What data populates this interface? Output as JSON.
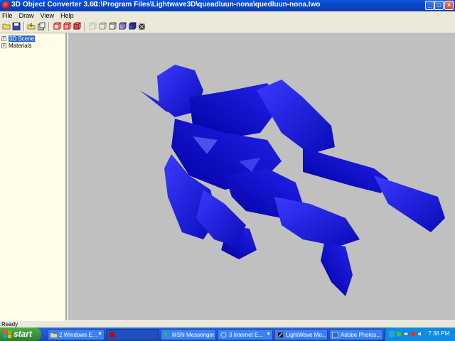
{
  "window": {
    "app_title": "3D Object Converter 3.60",
    "file_path": "C:\\Program Files\\Lightwave3D\\queadluun-nona\\quedluun-nona.lwo",
    "controls": [
      "_",
      "□",
      "×"
    ]
  },
  "menu": [
    "File",
    "Draw",
    "View",
    "Help"
  ],
  "toolbar_icons": [
    "open-folder-icon",
    "save-icon",
    "import-icon",
    "export-icon",
    "render-wire-icon",
    "render-flat-icon",
    "render-smooth-icon",
    "bbox-icon",
    "points-icon",
    "wireframe-icon",
    "flat-shade-icon",
    "gouraud-icon",
    "texture-icon"
  ],
  "tree": {
    "items": [
      {
        "label": "3D Scene",
        "expander": "+",
        "selected": true
      },
      {
        "label": "Materials",
        "expander": "+",
        "selected": false
      }
    ]
  },
  "viewport": {
    "background": "#c0c0c0",
    "model_color": "#1a1ae8"
  },
  "status": {
    "text": "Ready"
  },
  "taskbar": {
    "start_label": "start",
    "tasks": [
      {
        "label": "2 Windows E...",
        "has_arrow": true
      },
      {
        "label": "",
        "has_arrow": false
      },
      {
        "label": "MSN Messenger",
        "has_arrow": false
      },
      {
        "label": "3 Internet E...",
        "has_arrow": true
      },
      {
        "label": "LightWave Mo...",
        "has_arrow": false
      },
      {
        "label": "Adobe Photos...",
        "has_arrow": false
      }
    ],
    "clock": "7:38 PM"
  }
}
